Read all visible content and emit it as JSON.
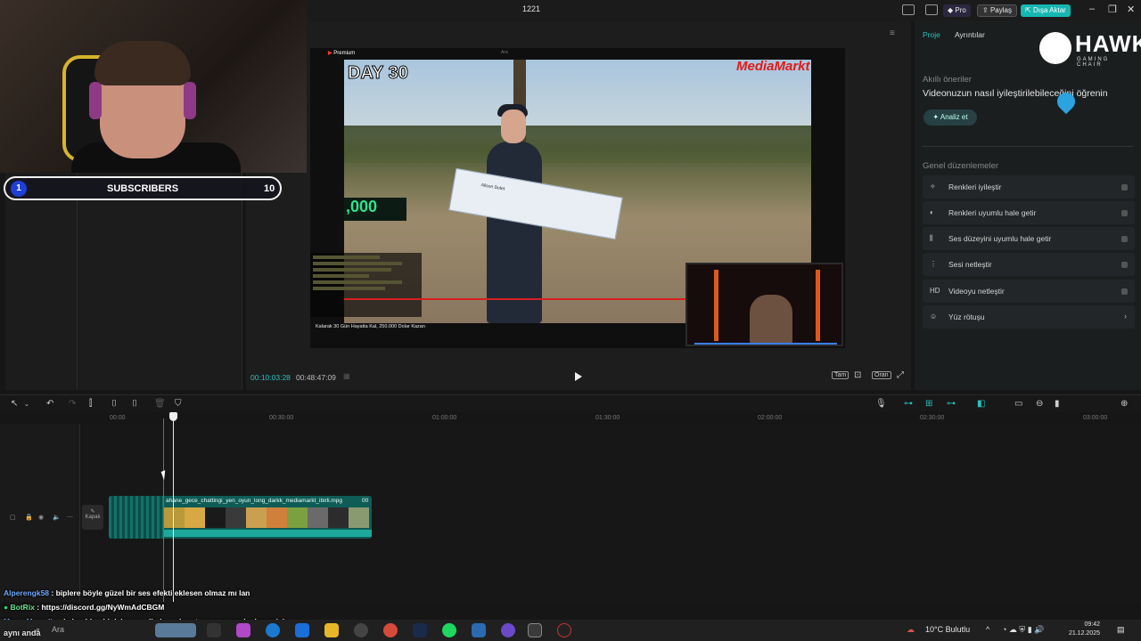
{
  "window": {
    "title": "1221"
  },
  "topbar": {
    "pro_label": "Pro",
    "share_label": "Paylaş",
    "export_label": "Dışa Aktar"
  },
  "webcam_overlay": {
    "subscribers_current": "1",
    "subscribers_label": "SUBSCRIBERS",
    "subscribers_goal": "10"
  },
  "preview": {
    "current_time": "00:10:03:28",
    "total_time": "00:48:47:09",
    "video_day_label": "DAY 30",
    "video_brand": "MediaMarkt",
    "video_score": ",000",
    "video_caption": "Kalarak 30 Gün Hayatta Kal, 250.000 Dolar Kazan",
    "check_name": "Alison Dolet",
    "yt_label": "Premium",
    "yt_search": "Ara",
    "buttons": {
      "full": "Tam",
      "ratio": "Oran"
    }
  },
  "right_panel": {
    "tabs": [
      "Proje",
      "Ayrıntılar"
    ],
    "logo_text": "HAWK",
    "logo_sub": "GAMING CHAIR",
    "ai_title": "Akıllı öneriler",
    "ai_headline": "Videonuzun nasıl iyileştirilebileceğini öğrenin",
    "analyze_label": "Analiz et",
    "general_title": "Genel düzenlemeler",
    "items": [
      {
        "icon": "✧",
        "label": "Renkleri iyileştir"
      },
      {
        "icon": "◐",
        "label": "Renkleri uyumlu hale getir"
      },
      {
        "icon": "⫼",
        "label": "Ses düzeyini uyumlu hale getir"
      },
      {
        "icon": "⋮",
        "label": "Sesi netleştir"
      },
      {
        "icon": "HD",
        "label": "Videoyu netleştir"
      },
      {
        "icon": "☺",
        "label": "Yüz rötuşu"
      }
    ]
  },
  "timeline": {
    "ruler": [
      "00:00",
      "00:30:00",
      "01:00:00",
      "01:30:00",
      "02:00:00",
      "02:30:00",
      "03:00:00"
    ],
    "kapak_label": "Kapak",
    "clip_name": "ahane_gece_chattingi_yen_oyun_long_darkk_mediamarkt_ibirli.mpg",
    "clip_duration": "00"
  },
  "chat": [
    {
      "user": "Alperengk58",
      "message": ": biplere böyle güzel bir ses efekti eklesen olmaz mı lan"
    },
    {
      "user": "BotRix",
      "message": ": https://discord.gg/NyWmAdCBGM"
    },
    {
      "user": "MauroMemoli",
      "message": ": skylandden bi daireye salimle mahmut sana gsrecek okey misin"
    }
  ],
  "taskbar": {
    "search_label": "Ara",
    "extra_line": "aynı anda",
    "weather": "10°C Bulutlu",
    "time": "09:42",
    "date": "21.12.2025"
  },
  "colors": {
    "accent": "#16b6b2",
    "timeline_clip": "#0f5c57",
    "chat_name": "#6da9ff"
  }
}
